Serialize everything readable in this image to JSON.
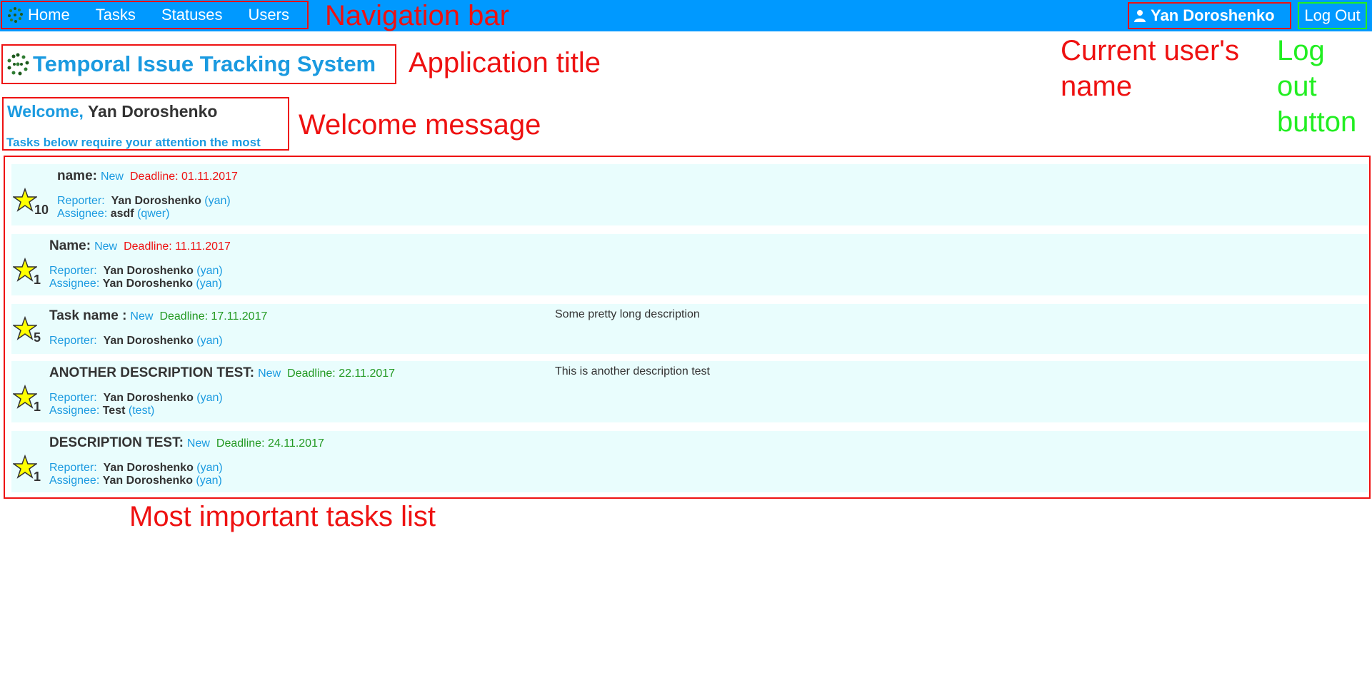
{
  "nav": {
    "items": [
      {
        "label": "Home"
      },
      {
        "label": "Tasks"
      },
      {
        "label": "Statuses"
      },
      {
        "label": "Users"
      }
    ],
    "user_name": "Yan Doroshenko",
    "logout_label": "Log Out"
  },
  "app_title": "Temporal Issue Tracking System",
  "welcome": {
    "greeting": "Welcome,",
    "name": "Yan Doroshenko",
    "subtitle": "Tasks below require your attention the most"
  },
  "labels": {
    "reporter": "Reporter:",
    "assignee": "Assignee:"
  },
  "tasks": [
    {
      "priority": "10",
      "name": "name:",
      "status": "New",
      "deadline": "Deadline: 01.11.2017",
      "deadline_state": "overdue",
      "reporter_name": "Yan Doroshenko",
      "reporter_login": "(yan)",
      "assignee_name": "asdf",
      "assignee_login": "(qwer)",
      "description": ""
    },
    {
      "priority": "1",
      "name": "Name:",
      "status": "New",
      "deadline": "Deadline: 11.11.2017",
      "deadline_state": "overdue",
      "reporter_name": "Yan Doroshenko",
      "reporter_login": "(yan)",
      "assignee_name": "Yan Doroshenko",
      "assignee_login": "(yan)",
      "description": ""
    },
    {
      "priority": "5",
      "name": "Task name :",
      "status": "New",
      "deadline": "Deadline: 17.11.2017",
      "deadline_state": "upcoming",
      "reporter_name": "Yan Doroshenko",
      "reporter_login": "(yan)",
      "description": "Some pretty long description"
    },
    {
      "priority": "1",
      "name": "ANOTHER DESCRIPTION TEST:",
      "status": "New",
      "deadline": "Deadline: 22.11.2017",
      "deadline_state": "upcoming",
      "reporter_name": "Yan Doroshenko",
      "reporter_login": "(yan)",
      "assignee_name": "Test",
      "assignee_login": "(test)",
      "description": "This is another description test"
    },
    {
      "priority": "1",
      "name": "DESCRIPTION TEST:",
      "status": "New",
      "deadline": "Deadline: 24.11.2017",
      "deadline_state": "upcoming",
      "reporter_name": "Yan Doroshenko",
      "reporter_login": "(yan)",
      "assignee_name": "Yan Doroshenko",
      "assignee_login": "(yan)",
      "description": ""
    }
  ],
  "annotations": {
    "navigation_bar": "Navigation bar",
    "application_title": "Application title",
    "current_user_name": "Current user's name",
    "logout_button": "Log out button",
    "welcome_message": "Welcome message",
    "tasks_list": "Most important tasks list"
  },
  "colors": {
    "navbar": "#0099ff",
    "accent": "#1a9ae0",
    "task_background": "#e9fdfd",
    "overdue": "#ee1111",
    "upcoming": "#229922",
    "annotation": "#ee1111",
    "annotation_logout": "#22ee22",
    "star_fill": "#ffff00"
  },
  "icons": {
    "app_logo": "dotted-circle-logo-icon",
    "user": "user-icon",
    "priority": "star-icon"
  }
}
